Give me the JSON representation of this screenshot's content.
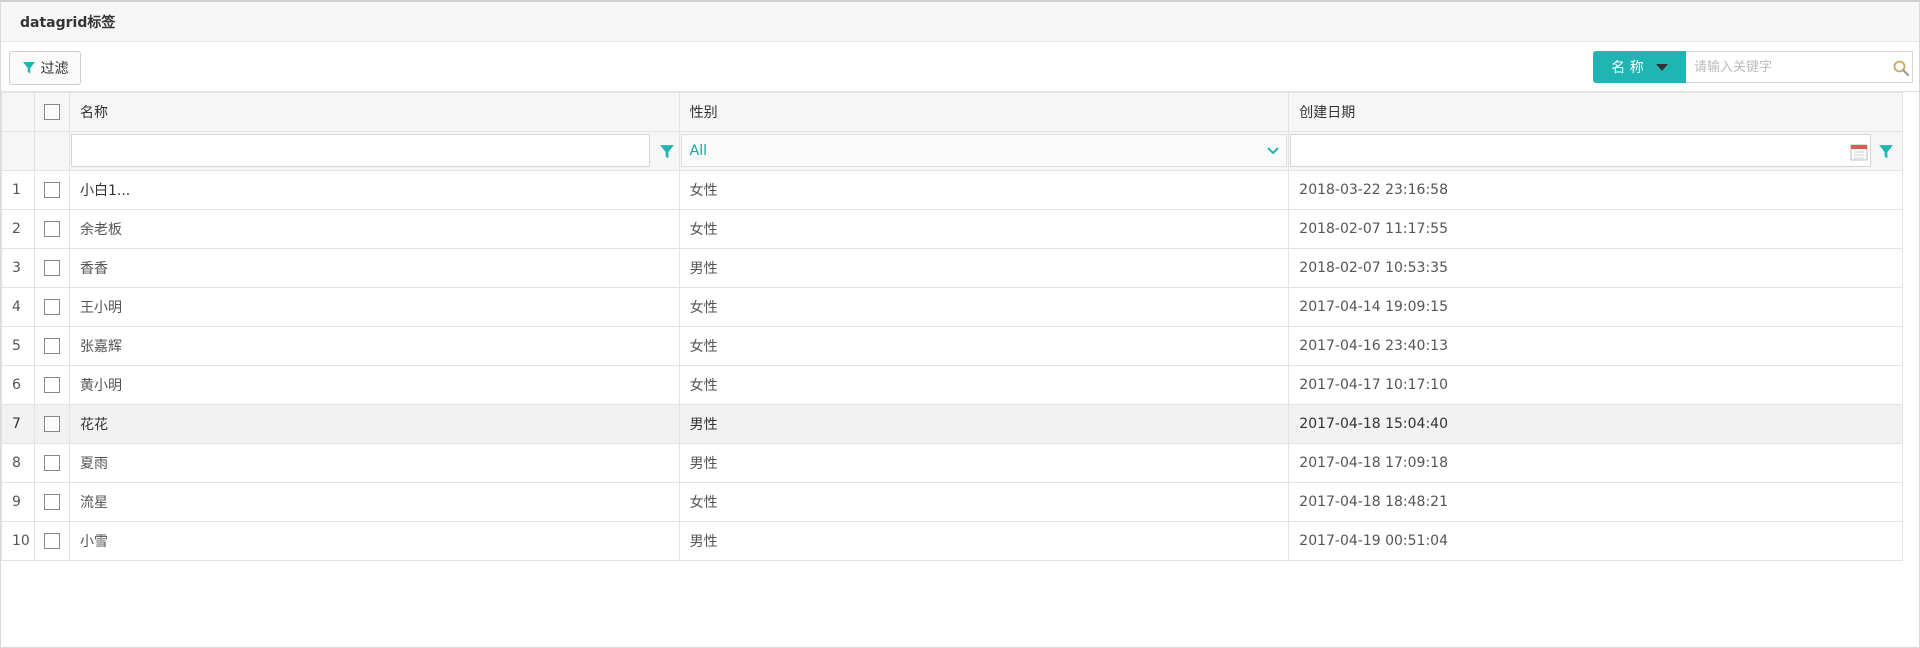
{
  "panel": {
    "title": "datagrid标签"
  },
  "toolbar": {
    "filter_label": "过滤",
    "search_type_label": "名 称",
    "search_placeholder": "请输入关键字",
    "search_value": ""
  },
  "columns": [
    {
      "key": "name",
      "label": "名称"
    },
    {
      "key": "sex",
      "label": "性别"
    },
    {
      "key": "date",
      "label": "创建日期"
    }
  ],
  "filters": {
    "name_value": "",
    "sex_selected": "All",
    "date_value": ""
  },
  "rows": [
    {
      "idx": "1",
      "name": "小白1...",
      "sex": "女性",
      "date": "2018-03-22 23:16:58"
    },
    {
      "idx": "2",
      "name": "余老板",
      "sex": "女性",
      "date": "2018-02-07 11:17:55"
    },
    {
      "idx": "3",
      "name": "香香",
      "sex": "男性",
      "date": "2018-02-07 10:53:35"
    },
    {
      "idx": "4",
      "name": "王小明",
      "sex": "女性",
      "date": "2017-04-14 19:09:15"
    },
    {
      "idx": "5",
      "name": "张嘉辉",
      "sex": "女性",
      "date": "2017-04-16 23:40:13"
    },
    {
      "idx": "6",
      "name": "黄小明",
      "sex": "女性",
      "date": "2017-04-17 10:17:10"
    },
    {
      "idx": "7",
      "name": "花花",
      "sex": "男性",
      "date": "2017-04-18 15:04:40"
    },
    {
      "idx": "8",
      "name": "夏雨",
      "sex": "男性",
      "date": "2017-04-18 17:09:18"
    },
    {
      "idx": "9",
      "name": "流星",
      "sex": "女性",
      "date": "2017-04-18 18:48:21"
    },
    {
      "idx": "10",
      "name": "小雪",
      "sex": "男性",
      "date": "2017-04-19 00:51:04"
    }
  ],
  "highlighted_row": 7,
  "colors": {
    "accent": "#1fb5b5",
    "filter_icon": "#1fb5b5",
    "select_text": "#1aa29f"
  },
  "icons": [
    "filter-icon",
    "caret-down-icon",
    "search-icon",
    "chevron-down-icon",
    "calendar-icon"
  ]
}
